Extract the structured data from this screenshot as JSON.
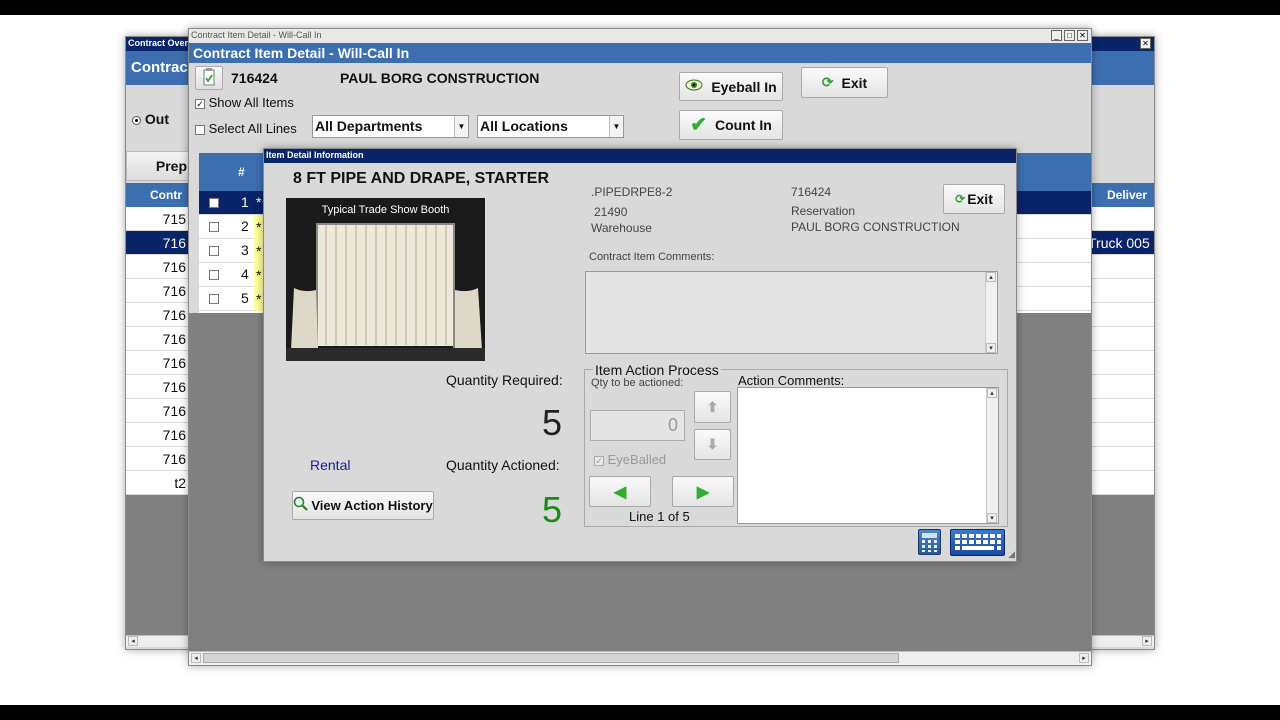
{
  "back_window": {
    "title": "Contract Overview",
    "header": "Contract",
    "radio_label": "Out",
    "tab_label": "Prep",
    "col_contract": "Contr",
    "col_deliver": "Deliver",
    "deliver_cell": "Truck 005",
    "rows": [
      "715",
      "716",
      "716",
      "716",
      "716",
      "716",
      "716",
      "716",
      "716",
      "716",
      "716",
      "t2"
    ]
  },
  "main_window": {
    "title": "Contract Item Detail - Will-Call In",
    "header": "Contract Item Detail - Will-Call In",
    "contract_no": "716424",
    "customer": "PAUL BORG CONSTRUCTION",
    "show_all_items": "Show All Items",
    "select_all_lines": "Select All Lines",
    "departments": "All Departments",
    "locations": "All Locations",
    "eyeball_in": "Eyeball In",
    "count_in": "Count In",
    "exit": "Exit",
    "grid_col_num": "#",
    "grid_rows": [
      "1",
      "2",
      "3",
      "4",
      "5"
    ],
    "grid_marks": [
      "*",
      "*",
      "*",
      "*",
      "*"
    ]
  },
  "dialog": {
    "title": "Item Detail Information",
    "item_name": "8 FT PIPE AND DRAPE, STARTER",
    "image_caption": "Typical Trade Show Booth",
    "code": ".PIPEDRPE8-2",
    "number": "21490",
    "location": "Warehouse",
    "contract": "716424",
    "status": "Reservation",
    "customer": "PAUL BORG CONSTRUCTION",
    "exit": "Exit",
    "comments_label": "Contract Item Comments:",
    "qty_required_label": "Quantity Required:",
    "qty_required": "5",
    "rental": "Rental",
    "qty_actioned_label": "Quantity Actioned:",
    "qty_actioned": "5",
    "view_history": "View Action History",
    "action_process_label": "Item Action Process",
    "qty_to_action_label": "Qty to be actioned:",
    "qty_to_action": "0",
    "eyeballed": "EyeBalled",
    "line_of": "Line 1 of 5",
    "action_comments_label": "Action Comments:"
  },
  "colors": {
    "titlebar": "#0a246a",
    "grid_header": "#3d6fb0",
    "selected_row": "#0a246a",
    "window_bg": "#d9d9d9",
    "empty_area": "#808080",
    "qty_actioned": "#1a8a1a",
    "rental": "#1a1a9a"
  }
}
